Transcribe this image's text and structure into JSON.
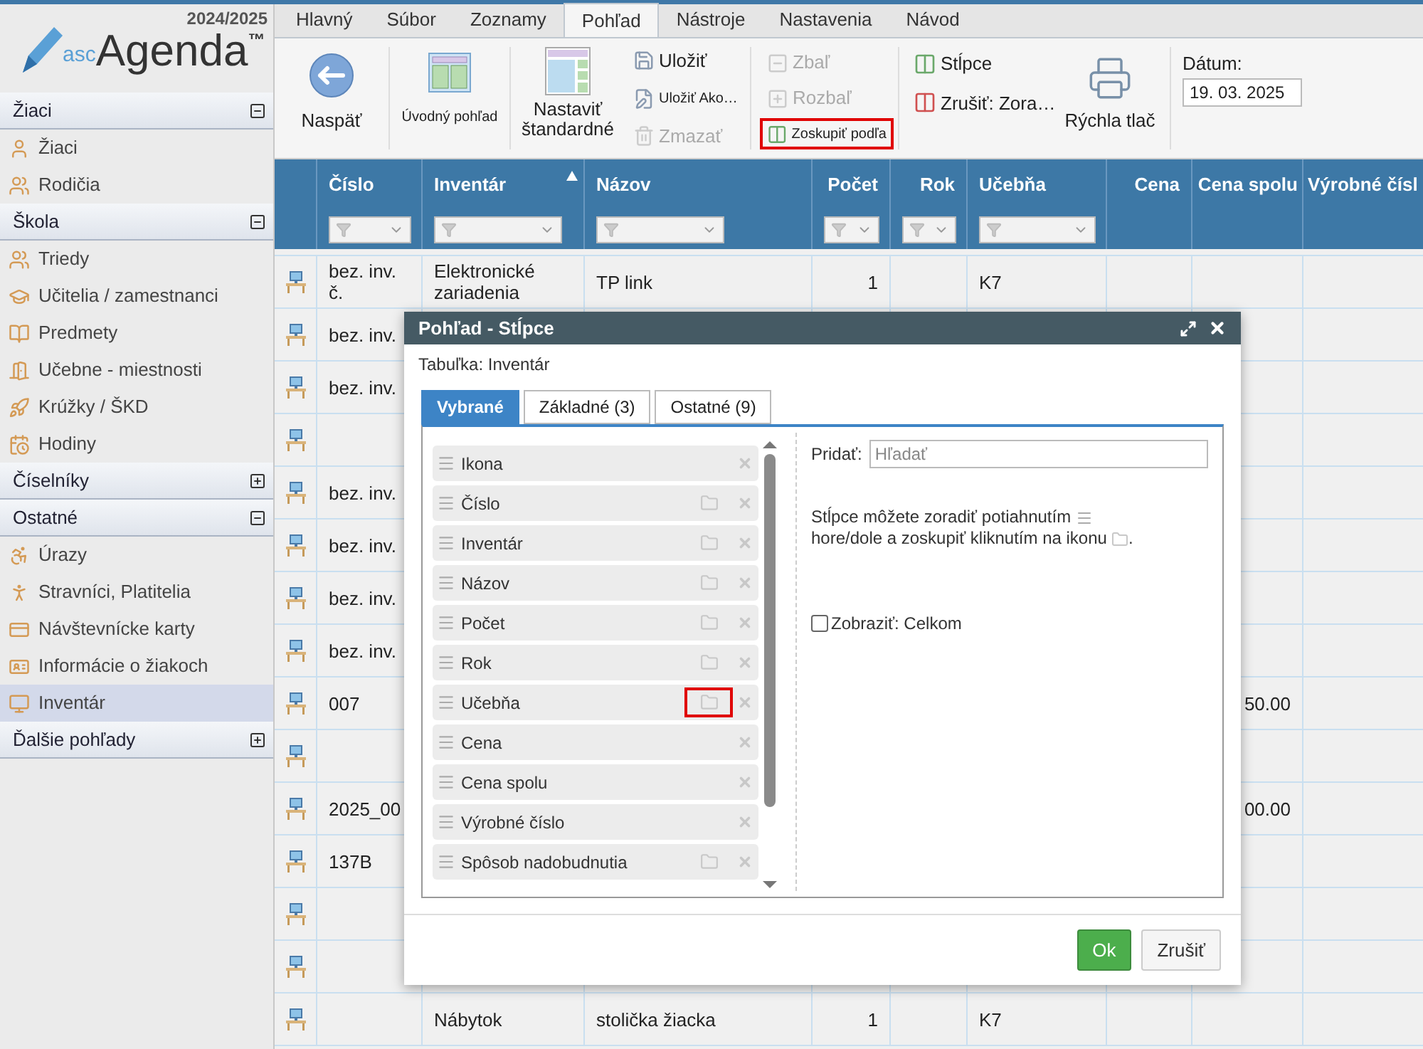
{
  "app": {
    "year": "2024/2025",
    "logo_prefix": "asc",
    "logo_name": "Agenda",
    "logo_mark": "™"
  },
  "sidebar": [
    {
      "title": "Žiaci",
      "expanded": true,
      "items": [
        {
          "label": "Žiaci",
          "selected": false
        },
        {
          "label": "Rodičia",
          "selected": false
        }
      ]
    },
    {
      "title": "Škola",
      "expanded": true,
      "items": [
        {
          "label": "Triedy",
          "selected": false
        },
        {
          "label": "Učitelia / zamestnanci",
          "selected": false
        },
        {
          "label": "Predmety",
          "selected": false
        },
        {
          "label": "Učebne - miestnosti",
          "selected": false
        },
        {
          "label": "Krúžky / ŠKD",
          "selected": false
        },
        {
          "label": "Hodiny",
          "selected": false
        }
      ]
    },
    {
      "title": "Číselníky",
      "expanded": false
    },
    {
      "title": "Ostatné",
      "expanded": true,
      "items": [
        {
          "label": "Úrazy",
          "selected": false
        },
        {
          "label": "Stravníci, Platitelia",
          "selected": false
        },
        {
          "label": "Návštevnícke karty",
          "selected": false
        },
        {
          "label": "Informácie o žiakoch",
          "selected": false
        },
        {
          "label": "Inventár",
          "selected": true
        }
      ]
    },
    {
      "title": "Ďalšie pohľady",
      "expanded": false
    }
  ],
  "menu_tabs": [
    {
      "label": "Hlavný",
      "selected": false
    },
    {
      "label": "Súbor",
      "selected": false
    },
    {
      "label": "Zoznamy",
      "selected": false
    },
    {
      "label": "Pohľad",
      "selected": true
    },
    {
      "label": "Nástroje",
      "selected": false
    },
    {
      "label": "Nastavenia",
      "selected": false
    },
    {
      "label": "Návod",
      "selected": false
    }
  ],
  "ribbon": {
    "big_buttons": [
      {
        "label": "Naspäť"
      },
      {
        "label": "Úvodný pohľad"
      },
      {
        "label": "Nastaviť štandardné"
      }
    ],
    "file_buttons": [
      {
        "label": "Uložiť",
        "disabled": false
      },
      {
        "label": "Uložiť Ako…",
        "disabled": false
      },
      {
        "label": "Zmazať",
        "disabled": true
      }
    ],
    "group_buttons": [
      {
        "label": "Zbaľ",
        "disabled": true,
        "highlighted": false
      },
      {
        "label": "Rozbaľ",
        "disabled": true,
        "highlighted": false
      },
      {
        "label": "Zoskupiť podľa",
        "disabled": false,
        "highlighted": true
      }
    ],
    "column_buttons": [
      {
        "label": "Stĺpce"
      },
      {
        "label": "Zrušiť: Zora…"
      }
    ],
    "print_button": {
      "label": "Rýchla tlač"
    },
    "date": {
      "label": "Dátum:",
      "value": "19. 03. 2025"
    }
  },
  "table": {
    "columns": [
      {
        "label": "Číslo",
        "filter": true,
        "sorted": false
      },
      {
        "label": "Inventár",
        "filter": true,
        "sorted": true
      },
      {
        "label": "Názov",
        "filter": true,
        "sorted": false
      },
      {
        "label": "Počet",
        "filter": true,
        "sorted": false
      },
      {
        "label": "Rok",
        "filter": true,
        "sorted": false
      },
      {
        "label": "Učebňa",
        "filter": true,
        "sorted": false
      },
      {
        "label": "Cena",
        "filter": false,
        "sorted": false
      },
      {
        "label": "Cena spolu",
        "filter": false,
        "sorted": false
      },
      {
        "label": "Výrobné čísl",
        "filter": false,
        "sorted": false
      }
    ],
    "rows": [
      {
        "cislo": "bez. inv. č.",
        "inventar": "Elektronické zariadenia",
        "nazov": "TP link",
        "pocet": "1",
        "ucebna": "K7"
      },
      {
        "cislo": "bez. inv."
      },
      {
        "cislo": "bez. inv."
      },
      {},
      {
        "cislo": "bez. inv."
      },
      {
        "cislo": "bez. inv."
      },
      {
        "cislo": "bez. inv."
      },
      {
        "cislo": "bez. inv."
      },
      {
        "cislo": "007",
        "cena_spolu": "50.00"
      },
      {},
      {
        "cislo": "2025_00",
        "cena_spolu": "00.00"
      },
      {
        "cislo": "137B"
      },
      {},
      {},
      {
        "inventar": "Nábytok",
        "nazov": "stolička žiacka",
        "pocet": "1",
        "ucebna": "K7"
      }
    ]
  },
  "dialog": {
    "title": "Pohľad - Stĺpce",
    "subtitle": "Tabuľka: Inventár",
    "tabs": [
      {
        "label": "Vybrané",
        "selected": true
      },
      {
        "label": "Základné (3)",
        "selected": false
      },
      {
        "label": "Ostatné (9)",
        "selected": false
      }
    ],
    "columns": [
      {
        "label": "Ikona",
        "groupable": false
      },
      {
        "label": "Číslo",
        "groupable": true,
        "highlighted": false
      },
      {
        "label": "Inventár",
        "groupable": true,
        "highlighted": false
      },
      {
        "label": "Názov",
        "groupable": true,
        "highlighted": false
      },
      {
        "label": "Počet",
        "groupable": true,
        "highlighted": false
      },
      {
        "label": "Rok",
        "groupable": true,
        "highlighted": false
      },
      {
        "label": "Učebňa",
        "groupable": true,
        "highlighted": true
      },
      {
        "label": "Cena",
        "groupable": false
      },
      {
        "label": "Cena spolu",
        "groupable": false
      },
      {
        "label": "Výrobné číslo",
        "groupable": false
      },
      {
        "label": "Spôsob nadobudnutia",
        "groupable": true,
        "highlighted": false
      }
    ],
    "add_label": "Pridať:",
    "search": {
      "placeholder": "Hľadať"
    },
    "help": [
      "Stĺpce môžete zoradiť potiahnutím",
      "hore/dole a zoskupiť kliknutím na ikonu",
      "."
    ],
    "show_total": {
      "label": "Zobraziť: Celkom",
      "checked": false
    },
    "buttons": [
      {
        "label": "Ok",
        "kind": "primary"
      },
      {
        "label": "Zrušiť",
        "kind": "secondary"
      }
    ]
  }
}
